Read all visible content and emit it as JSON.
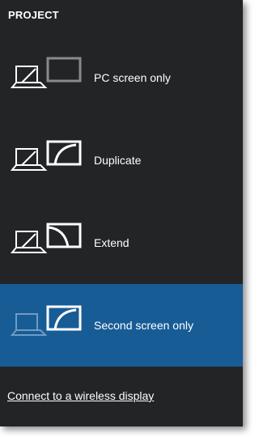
{
  "panel": {
    "title": "PROJECT"
  },
  "options": [
    {
      "label": "PC screen only",
      "selected": false,
      "laptop_icon": "laptop-icon",
      "monitor_icon": "monitor-icon"
    },
    {
      "label": "Duplicate",
      "selected": false,
      "laptop_icon": "laptop-icon",
      "monitor_icon": "monitor-icon"
    },
    {
      "label": "Extend",
      "selected": false,
      "laptop_icon": "laptop-icon",
      "monitor_icon": "monitor-icon"
    },
    {
      "label": "Second screen only",
      "selected": true,
      "laptop_icon": "laptop-icon",
      "monitor_icon": "monitor-icon"
    }
  ],
  "footer": {
    "wireless_link": "Connect to a wireless display"
  },
  "colors": {
    "panel_bg": "#232425",
    "selected_bg": "#185c96",
    "active_icon": "#ffffff",
    "dim_monitor": "#8a8a8a",
    "dim_laptop": "#6e9cc4",
    "text": "#ffffff"
  }
}
